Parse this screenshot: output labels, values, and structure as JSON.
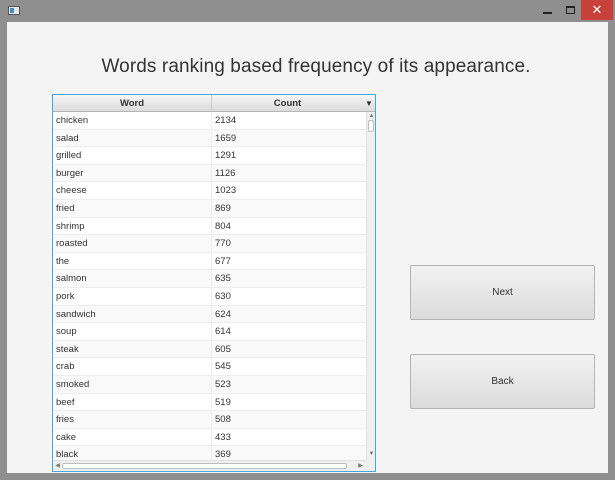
{
  "window": {
    "controls": {
      "minimize": "minimize",
      "maximize": "maximize",
      "close": "✕"
    }
  },
  "heading": "Words ranking based frequency of its appearance.",
  "table": {
    "columns": {
      "word": "Word",
      "count": "Count"
    },
    "sort_indicator": "▼",
    "rows": [
      {
        "word": "chicken",
        "count": "2134"
      },
      {
        "word": "salad",
        "count": "1659"
      },
      {
        "word": "grilled",
        "count": "1291"
      },
      {
        "word": "burger",
        "count": "1126"
      },
      {
        "word": "cheese",
        "count": "1023"
      },
      {
        "word": "fried",
        "count": "869"
      },
      {
        "word": "shrimp",
        "count": "804"
      },
      {
        "word": "roasted",
        "count": "770"
      },
      {
        "word": "the",
        "count": "677"
      },
      {
        "word": "salmon",
        "count": "635"
      },
      {
        "word": "pork",
        "count": "630"
      },
      {
        "word": "sandwich",
        "count": "624"
      },
      {
        "word": "soup",
        "count": "614"
      },
      {
        "word": "steak",
        "count": "605"
      },
      {
        "word": "crab",
        "count": "545"
      },
      {
        "word": "smoked",
        "count": "523"
      },
      {
        "word": "beef",
        "count": "519"
      },
      {
        "word": "fries",
        "count": "508"
      },
      {
        "word": "cake",
        "count": "433"
      },
      {
        "word": "black",
        "count": "369"
      }
    ]
  },
  "buttons": {
    "next": "Next",
    "back": "Back"
  },
  "colors": {
    "accent": "#47a5dd",
    "close": "#c7413a",
    "background": "#f4f4f4"
  }
}
